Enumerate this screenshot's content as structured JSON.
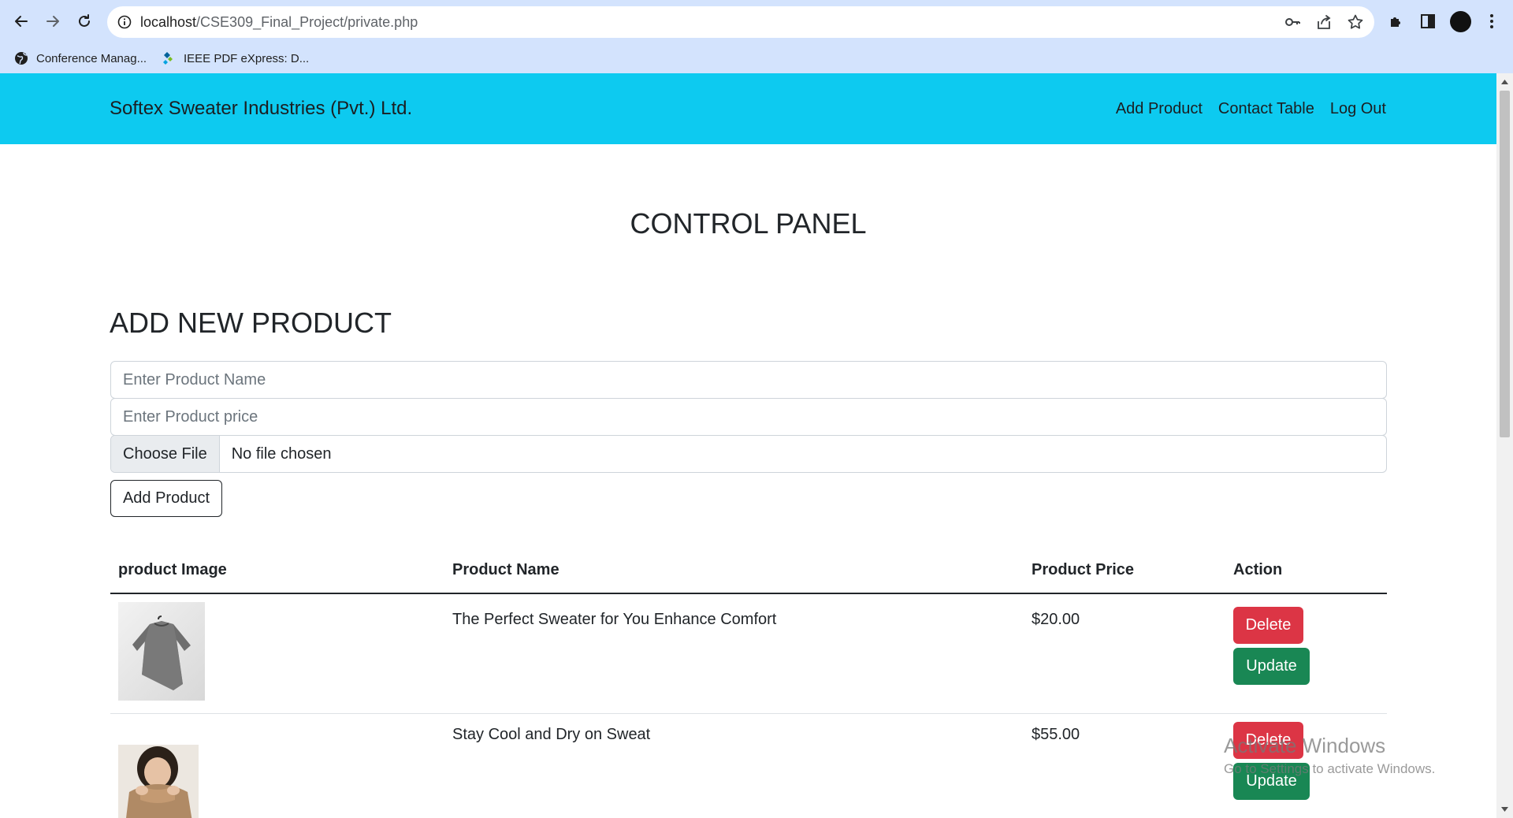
{
  "browser": {
    "url_host": "localhost",
    "url_path": "/CSE309_Final_Project/private.php",
    "bookmarks": [
      {
        "label": "Conference Manag..."
      },
      {
        "label": "IEEE PDF eXpress: D..."
      }
    ]
  },
  "navbar": {
    "brand": "Softex Sweater Industries (Pvt.) Ltd.",
    "links": [
      "Add Product",
      "Contact Table",
      "Log Out"
    ],
    "color": "#0dcaf0"
  },
  "page": {
    "title": "CONTROL PANEL",
    "form_heading": "ADD NEW PRODUCT"
  },
  "form": {
    "name_placeholder": "Enter Product Name",
    "price_placeholder": "Enter Product price",
    "file_button": "Choose File",
    "file_status": "No file chosen",
    "submit_label": "Add Product"
  },
  "table": {
    "headers": [
      "product Image",
      "Product Name",
      "Product Price",
      "Action"
    ],
    "rows": [
      {
        "name": "The Perfect Sweater for You Enhance Comfort",
        "price": "$20.00",
        "delete_label": "Delete",
        "update_label": "Update"
      },
      {
        "name": "Stay Cool and Dry on Sweat",
        "price": "$55.00",
        "delete_label": "Delete",
        "update_label": "Update"
      }
    ]
  },
  "watermark": {
    "line1": "Activate Windows",
    "line2": "Go to Settings to activate Windows."
  },
  "colors": {
    "danger": "#dc3545",
    "success": "#198754",
    "chrome": "#d3e3fd"
  }
}
